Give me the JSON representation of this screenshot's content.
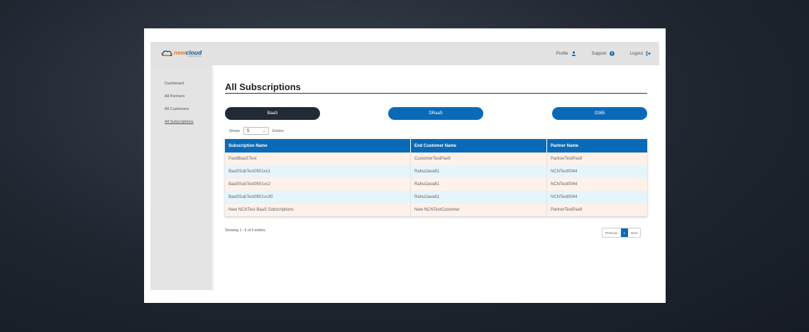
{
  "brand": {
    "name_part1": "new",
    "name_part2": "cloud",
    "tagline": "NETWORKS"
  },
  "header": {
    "links": [
      {
        "label": "Profile",
        "icon": "user-icon"
      },
      {
        "label": "Support",
        "icon": "help-circle-icon"
      },
      {
        "label": "Logout",
        "icon": "logout-icon"
      }
    ]
  },
  "sidebar": {
    "items": [
      {
        "label": "Dashboard",
        "active": false
      },
      {
        "label": "All Partners",
        "active": false
      },
      {
        "label": "All Customers",
        "active": false
      },
      {
        "label": "All Subscriptions",
        "active": true
      }
    ]
  },
  "main": {
    "title": "All Subscriptions",
    "tabs": [
      {
        "label": "BaaS",
        "selected": true
      },
      {
        "label": "DRaaS",
        "selected": false
      },
      {
        "label": "O365",
        "selected": false
      }
    ],
    "length_control": {
      "prefix": "Shows",
      "value": "5",
      "suffix": "Entries"
    },
    "table": {
      "headers": [
        "Subscription Name",
        "End Customer Name",
        "Partner Name"
      ],
      "rows": [
        [
          "Pax8BaaSTest",
          "CustomerTestPax8",
          "PartnerTestPax8"
        ],
        [
          "BaaSSubTest0501vc1",
          "RahulJava81",
          "NCNTest0044"
        ],
        [
          "BaaSSubTest0501vc2",
          "RahulJava81",
          "NCNTest0044"
        ],
        [
          "BaaSSubTest0501vc30",
          "RahulJava81",
          "NCNTest0044"
        ],
        [
          "New NCNTest BaaS Subscriptions",
          "New NCNTestCustomer",
          "PartnerTestPax8"
        ]
      ]
    },
    "footer_info": "Showing 1 - 5 of 5 entries",
    "pagination": {
      "previous": "Previous",
      "current": "1",
      "next": "Next"
    }
  },
  "colors": {
    "accent": "#0a6ab7",
    "selected_tab": "#222a35",
    "brand_orange": "#e87722"
  }
}
